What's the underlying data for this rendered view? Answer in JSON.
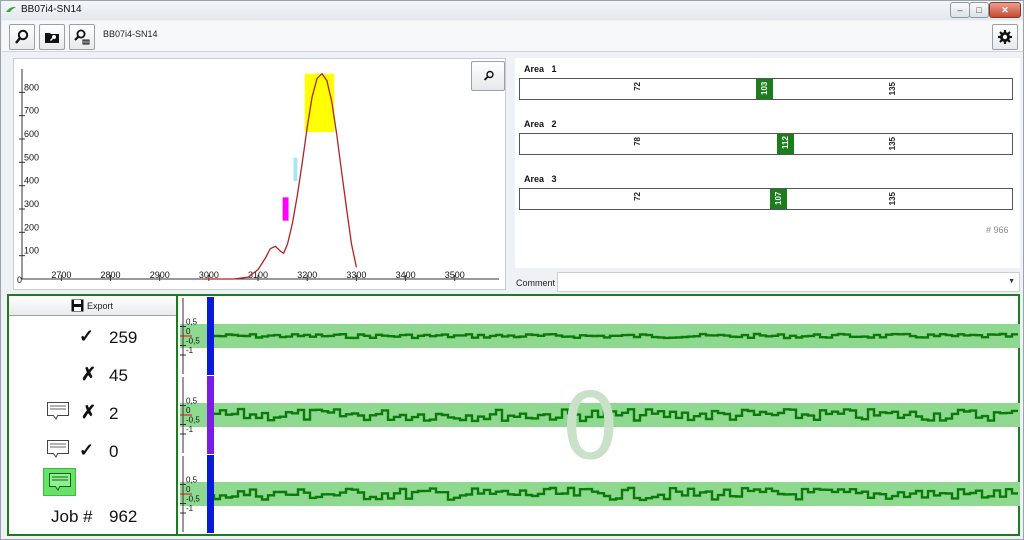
{
  "window": {
    "title": "BB07i4-SN14",
    "controls": [
      "–",
      "□",
      "✕"
    ]
  },
  "toolbar": {
    "serial": "BB07i4-SN14"
  },
  "chart_data": {
    "type": "line",
    "x_ticks": [
      "2700",
      "2800",
      "2900",
      "3000",
      "3100",
      "3200",
      "3300",
      "3400",
      "3500"
    ],
    "y_ticks": [
      "100",
      "200",
      "300",
      "400",
      "500",
      "600",
      "700",
      "800"
    ],
    "y_zero_label": "0",
    "xlim": [
      2620,
      3590
    ],
    "ylim": [
      0,
      900
    ],
    "curve": [
      [
        2990,
        0
      ],
      [
        3050,
        0
      ],
      [
        3080,
        8
      ],
      [
        3100,
        40
      ],
      [
        3115,
        90
      ],
      [
        3125,
        130
      ],
      [
        3135,
        140
      ],
      [
        3145,
        120
      ],
      [
        3152,
        110
      ],
      [
        3160,
        150
      ],
      [
        3170,
        240
      ],
      [
        3180,
        360
      ],
      [
        3190,
        500
      ],
      [
        3200,
        650
      ],
      [
        3210,
        780
      ],
      [
        3220,
        860
      ],
      [
        3230,
        880
      ],
      [
        3240,
        850
      ],
      [
        3250,
        760
      ],
      [
        3260,
        620
      ],
      [
        3270,
        460
      ],
      [
        3280,
        300
      ],
      [
        3290,
        150
      ],
      [
        3300,
        50
      ]
    ],
    "highlights": [
      {
        "color": "#ff00ff",
        "x0": 3150,
        "x1": 3162,
        "y": 250,
        "y1": 350
      },
      {
        "color": "#a6e7f2",
        "x0": 3172,
        "x1": 3180,
        "y": 420,
        "y1": 520
      },
      {
        "color": "#ffff00",
        "x0": 3195,
        "x1": 3255,
        "y": 630,
        "y1": 880
      }
    ],
    "line_color": "#b22222",
    "grid": false
  },
  "areas": [
    {
      "label": "Area",
      "num": "1",
      "left_val": "72",
      "green_val": "103",
      "right_val": "135"
    },
    {
      "label": "Area",
      "num": "2",
      "left_val": "78",
      "green_val": "112",
      "right_val": "135"
    },
    {
      "label": "Area",
      "num": "3",
      "left_val": "72",
      "green_val": "107",
      "right_val": "135"
    }
  ],
  "count_label": "# 966",
  "comment": {
    "label": "Comment",
    "value": ""
  },
  "export": {
    "label": "Export"
  },
  "stats": [
    {
      "mark": "✓",
      "value": "259"
    },
    {
      "mark": "✗",
      "value": "45"
    },
    {
      "mark": "✗",
      "value": "2"
    },
    {
      "mark": "✓",
      "value": "0"
    }
  ],
  "job": {
    "label": "Job #",
    "value": "962"
  },
  "signal_graphs": {
    "y_ticks": [
      "0,5",
      "0",
      "-0,5",
      "-1"
    ],
    "strip_colors": [
      "#0a1ad6",
      "#7a1ee0",
      "#0a1ad6"
    ],
    "big_value": "0",
    "band_color": "#8fd88f",
    "bar_color": "#0b7a0b"
  },
  "colors": {
    "accent": "#1c7d1c"
  }
}
